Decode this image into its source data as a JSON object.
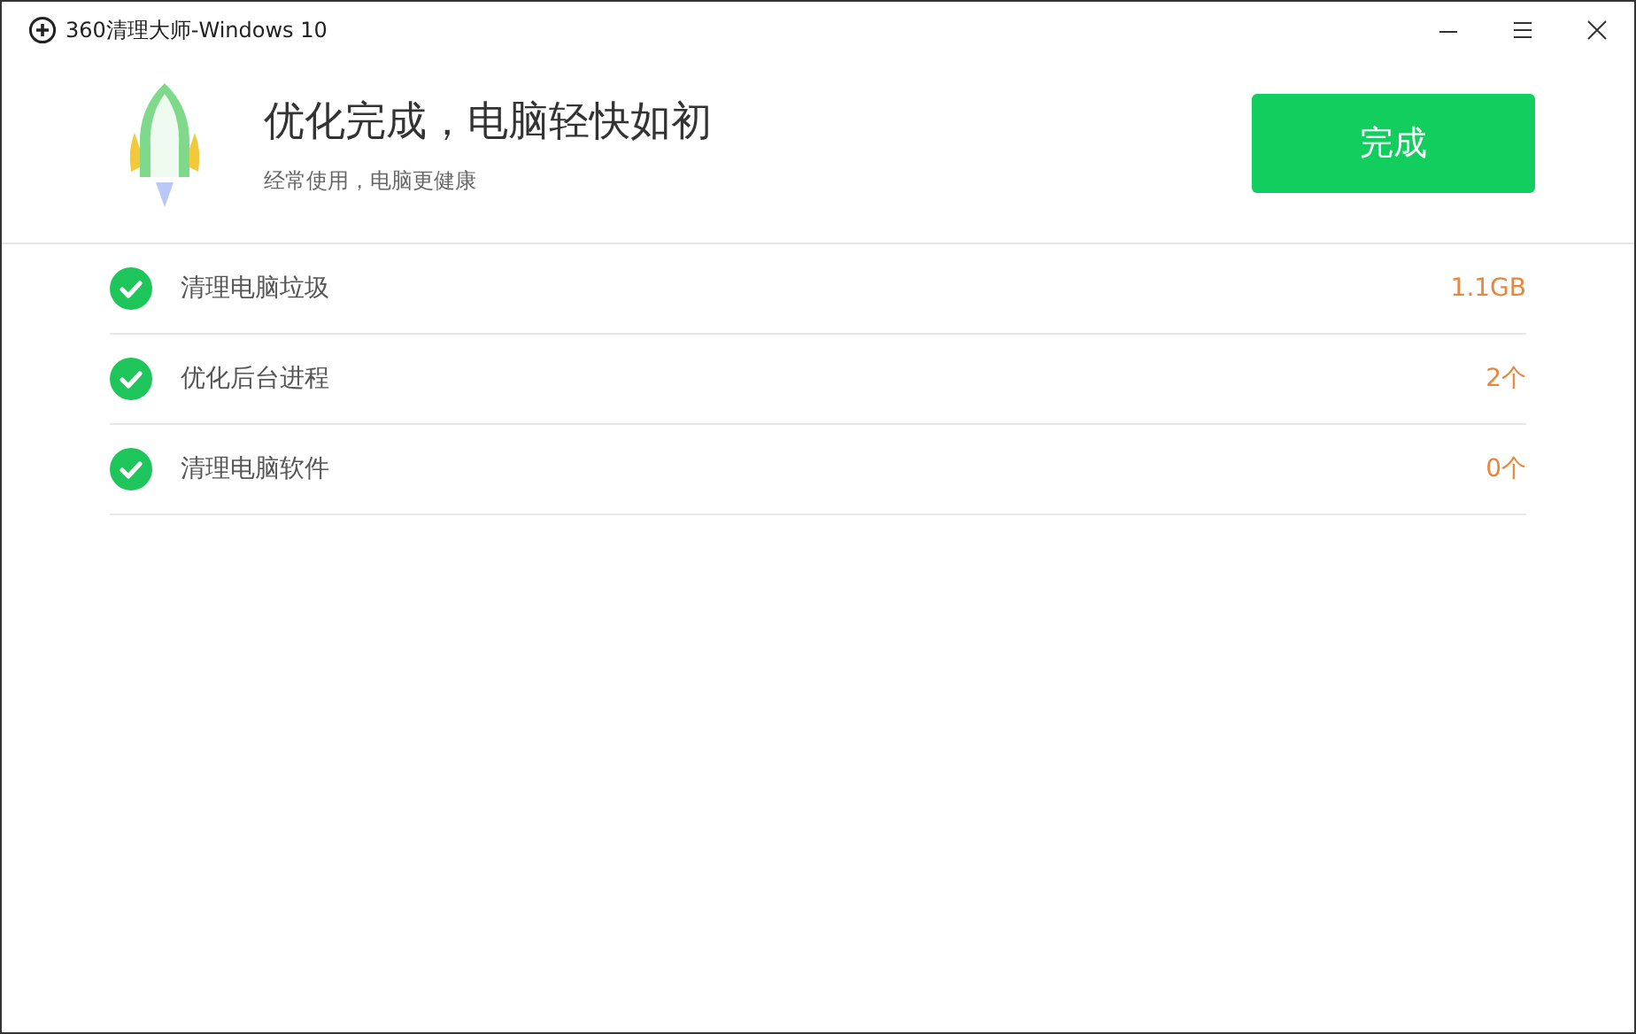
{
  "window": {
    "title": "360清理大师-Windows 10"
  },
  "header": {
    "headline": "优化完成，电脑轻快如初",
    "subtitle": "经常使用，电脑更健康",
    "button": "完成"
  },
  "results": [
    {
      "label": "清理电脑垃圾",
      "value": "1.1GB",
      "done": true
    },
    {
      "label": "优化后台进程",
      "value": "2个",
      "done": true
    },
    {
      "label": "清理电脑软件",
      "value": "0个",
      "done": true
    }
  ]
}
